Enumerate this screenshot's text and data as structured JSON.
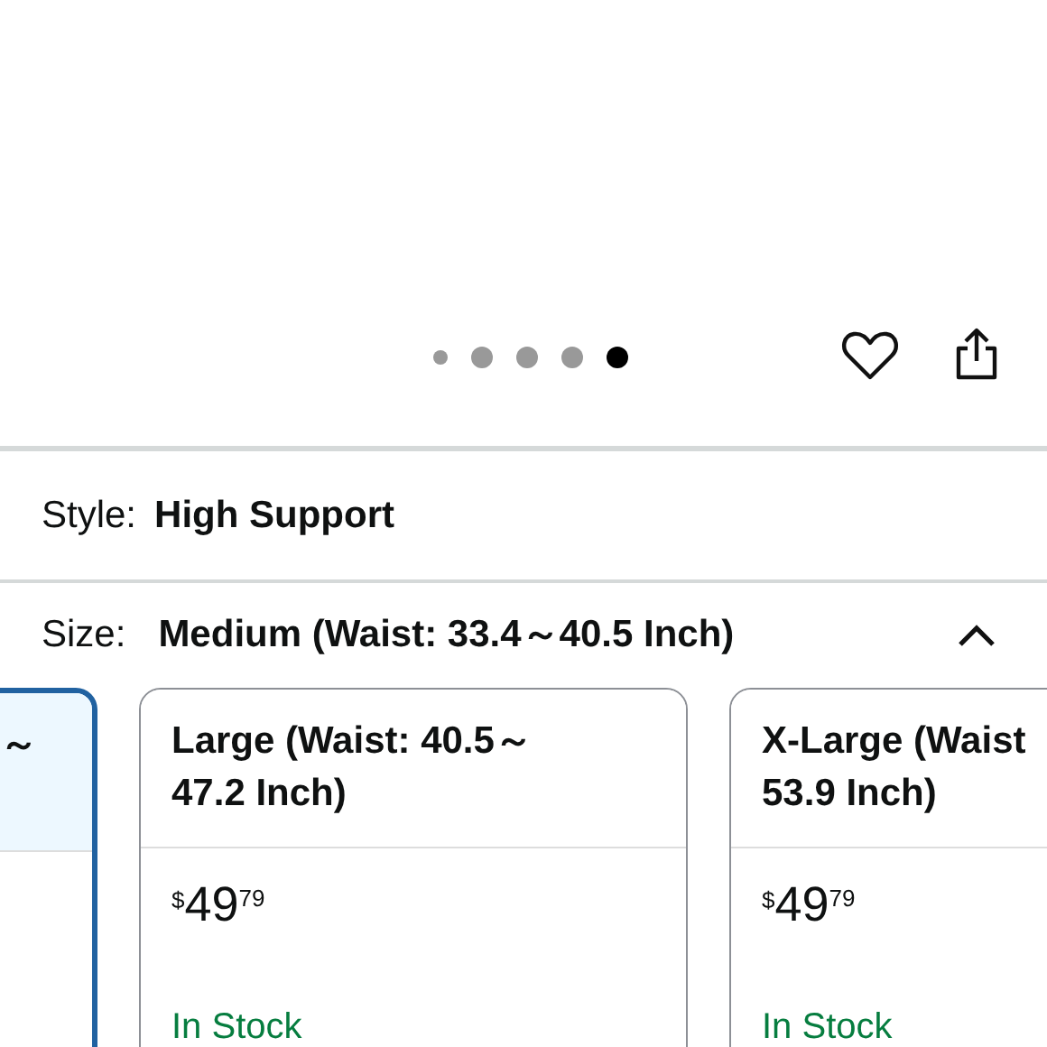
{
  "carousel_dots": [
    {
      "selected": false
    },
    {
      "selected": false
    },
    {
      "selected": false
    },
    {
      "selected": false
    },
    {
      "selected": true
    }
  ],
  "style": {
    "label": "Style:",
    "value": "High Support"
  },
  "size": {
    "label": "Size:",
    "value": "Medium (Waist: 33.4～40.5 Inch)",
    "expanded": true
  },
  "size_options": [
    {
      "title_lines": [
        "～"
      ],
      "selected": true
    },
    {
      "title_lines": [
        "Large (Waist: 40.5～",
        "47.2 Inch)"
      ],
      "selected": false,
      "price": {
        "symbol": "$",
        "whole": "49",
        "fraction": "79"
      },
      "availability": "In Stock"
    },
    {
      "title_lines": [
        "X-Large (Waist",
        "53.9 Inch)"
      ],
      "selected": false,
      "price": {
        "symbol": "$",
        "whole": "49",
        "fraction": "79"
      },
      "availability": "In Stock"
    }
  ]
}
